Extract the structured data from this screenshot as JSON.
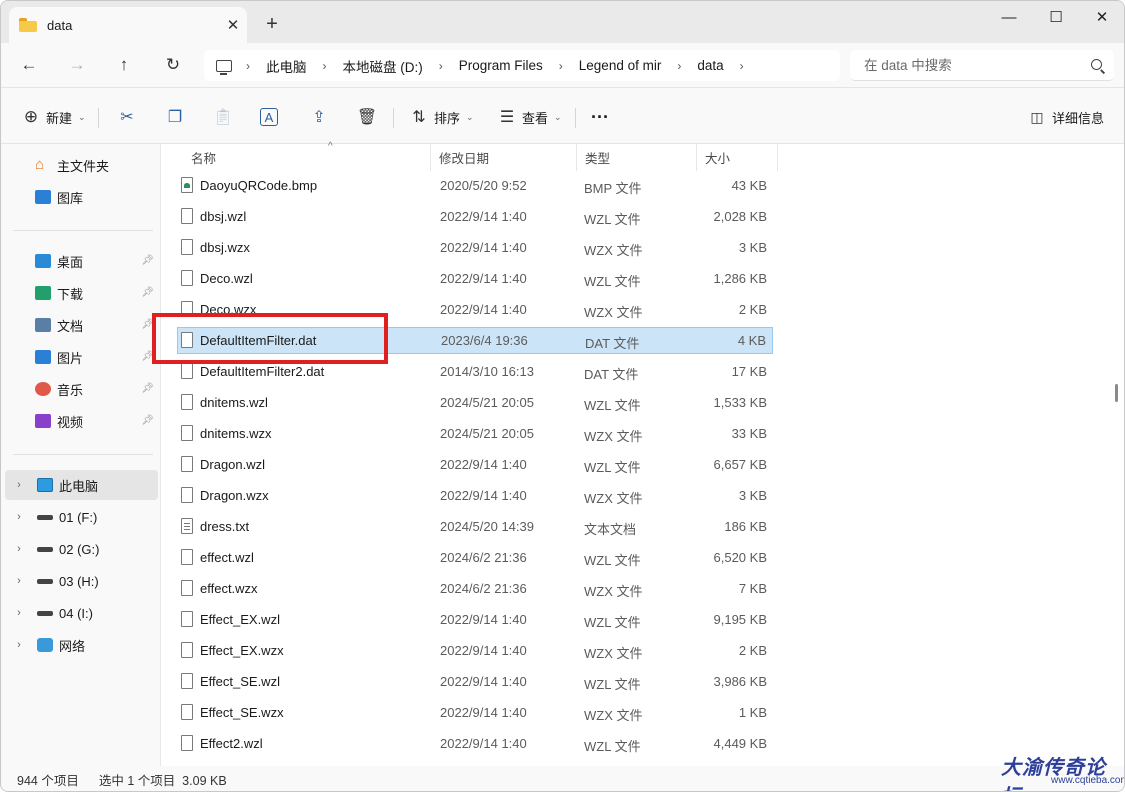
{
  "window": {
    "tab_title": "data",
    "close_tab": "✕",
    "new_tab": "+",
    "minimize": "—",
    "maximize": "☐",
    "close": "✕"
  },
  "nav": {
    "back": "←",
    "forward": "→",
    "up": "↑",
    "refresh": "↻",
    "breadcrumb": [
      "此电脑",
      "本地磁盘 (D:)",
      "Program Files",
      "Legend of mir",
      "data"
    ],
    "search_placeholder": "在 data 中搜索"
  },
  "commands": {
    "new": "新建",
    "sort": "排序",
    "view": "查看",
    "more": "···",
    "details": "详细信息"
  },
  "sidebar": {
    "home": "主文件夹",
    "gallery": "图库",
    "quick": [
      {
        "label": "桌面",
        "color": "#2b8ad6"
      },
      {
        "label": "下载",
        "color": "#22a06b"
      },
      {
        "label": "文档",
        "color": "#5a7ea8"
      },
      {
        "label": "图片",
        "color": "#2b7fd4"
      },
      {
        "label": "音乐",
        "color": "#e0584a"
      },
      {
        "label": "视频",
        "color": "#8a3ec9"
      }
    ],
    "thispc": "此电脑",
    "drives": [
      "01 (F:)",
      "02 (G:)",
      "03 (H:)",
      "04 (I:)"
    ],
    "network": "网络"
  },
  "columns": {
    "name": "名称",
    "date": "修改日期",
    "type": "类型",
    "size": "大小"
  },
  "files": [
    {
      "name": "DaoyuQRCode.bmp",
      "date": "2020/5/20 9:52",
      "type": "BMP 文件",
      "size": "43 KB",
      "icon": "img"
    },
    {
      "name": "dbsj.wzl",
      "date": "2022/9/14 1:40",
      "type": "WZL 文件",
      "size": "2,028 KB",
      "icon": "file"
    },
    {
      "name": "dbsj.wzx",
      "date": "2022/9/14 1:40",
      "type": "WZX 文件",
      "size": "3 KB",
      "icon": "file"
    },
    {
      "name": "Deco.wzl",
      "date": "2022/9/14 1:40",
      "type": "WZL 文件",
      "size": "1,286 KB",
      "icon": "file"
    },
    {
      "name": "Deco.wzx",
      "date": "2022/9/14 1:40",
      "type": "WZX 文件",
      "size": "2 KB",
      "icon": "file"
    },
    {
      "name": "DefaultItemFilter.dat",
      "date": "2023/6/4 19:36",
      "type": "DAT 文件",
      "size": "4 KB",
      "icon": "file",
      "selected": true
    },
    {
      "name": "DefaultItemFilter2.dat",
      "date": "2014/3/10 16:13",
      "type": "DAT 文件",
      "size": "17 KB",
      "icon": "file"
    },
    {
      "name": "dnitems.wzl",
      "date": "2024/5/21 20:05",
      "type": "WZL 文件",
      "size": "1,533 KB",
      "icon": "file"
    },
    {
      "name": "dnitems.wzx",
      "date": "2024/5/21 20:05",
      "type": "WZX 文件",
      "size": "33 KB",
      "icon": "file"
    },
    {
      "name": "Dragon.wzl",
      "date": "2022/9/14 1:40",
      "type": "WZL 文件",
      "size": "6,657 KB",
      "icon": "file"
    },
    {
      "name": "Dragon.wzx",
      "date": "2022/9/14 1:40",
      "type": "WZX 文件",
      "size": "3 KB",
      "icon": "file"
    },
    {
      "name": "dress.txt",
      "date": "2024/5/20 14:39",
      "type": "文本文档",
      "size": "186 KB",
      "icon": "txt"
    },
    {
      "name": "effect.wzl",
      "date": "2024/6/2 21:36",
      "type": "WZL 文件",
      "size": "6,520 KB",
      "icon": "file"
    },
    {
      "name": "effect.wzx",
      "date": "2024/6/2 21:36",
      "type": "WZX 文件",
      "size": "7 KB",
      "icon": "file"
    },
    {
      "name": "Effect_EX.wzl",
      "date": "2022/9/14 1:40",
      "type": "WZL 文件",
      "size": "9,195 KB",
      "icon": "file"
    },
    {
      "name": "Effect_EX.wzx",
      "date": "2022/9/14 1:40",
      "type": "WZX 文件",
      "size": "2 KB",
      "icon": "file"
    },
    {
      "name": "Effect_SE.wzl",
      "date": "2022/9/14 1:40",
      "type": "WZL 文件",
      "size": "3,986 KB",
      "icon": "file"
    },
    {
      "name": "Effect_SE.wzx",
      "date": "2022/9/14 1:40",
      "type": "WZX 文件",
      "size": "1 KB",
      "icon": "file"
    },
    {
      "name": "Effect2.wzl",
      "date": "2022/9/14 1:40",
      "type": "WZL 文件",
      "size": "4,449 KB",
      "icon": "file"
    }
  ],
  "status": {
    "count": "944 个项目",
    "selection": "选中 1 个项目  3.09 KB"
  },
  "watermark": {
    "text": "大渝传奇论坛",
    "url": "www.cqtieba.com"
  }
}
